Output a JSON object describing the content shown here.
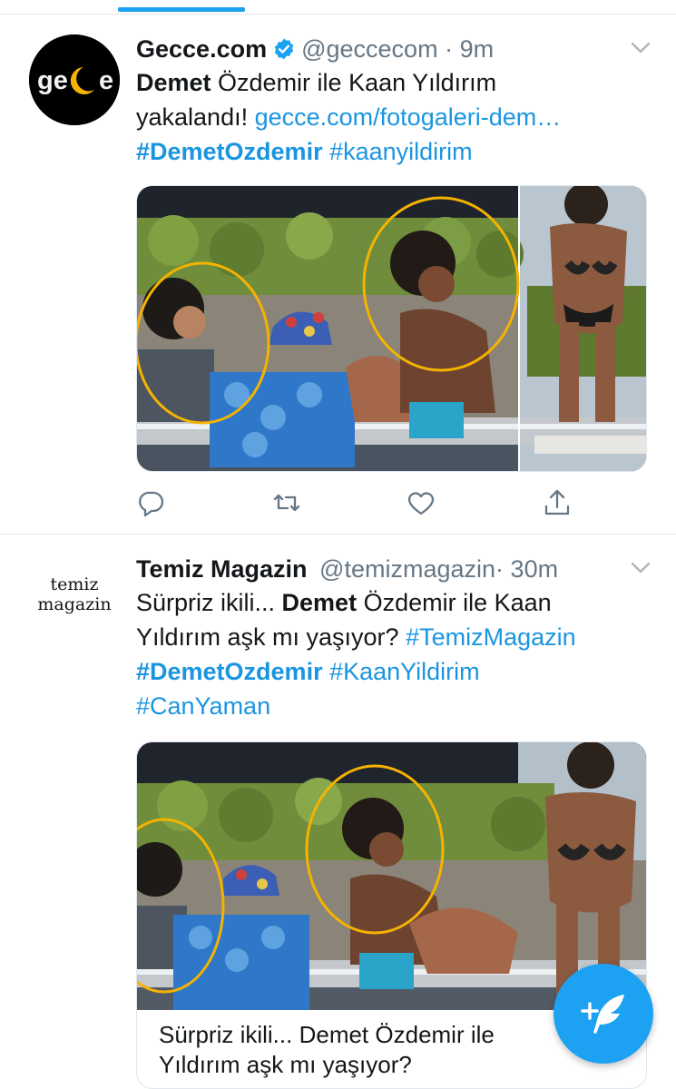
{
  "tweets": [
    {
      "author": {
        "display_name": "Gecce.com",
        "handle": "@geccecom",
        "verified": true,
        "avatar_text": "gecce"
      },
      "time": "9m",
      "separator": "·",
      "text_lines": [
        {
          "parts": [
            {
              "text": "Demet",
              "style": "bold"
            },
            {
              "text": " Özdemir ile Kaan Yıldırım",
              "style": "plain"
            }
          ]
        },
        {
          "parts": [
            {
              "text": "yakalandı! ",
              "style": "plain"
            },
            {
              "text": "gecce.com/fotogaleri-dem…",
              "style": "link"
            }
          ]
        },
        {
          "parts": [
            {
              "text": "#DemetOzdemir",
              "style": "hashtag-bold"
            },
            {
              "text": " #kaanyildirim",
              "style": "link"
            }
          ]
        }
      ]
    },
    {
      "author": {
        "display_name": "Temiz Magazin",
        "handle": "@temizmagazin",
        "verified": false,
        "avatar_line1": "temiz",
        "avatar_line2": "magazin"
      },
      "time": "30m",
      "separator": "·",
      "text_lines": [
        {
          "parts": [
            {
              "text": "Sürpriz ikili... ",
              "style": "plain"
            },
            {
              "text": "Demet",
              "style": "bold"
            },
            {
              "text": " Özdemir ile Kaan",
              "style": "plain"
            }
          ]
        },
        {
          "parts": [
            {
              "text": "Yıldırım aşk mı yaşıyor? ",
              "style": "plain"
            },
            {
              "text": "#TemizMagazin",
              "style": "link"
            }
          ]
        },
        {
          "parts": [
            {
              "text": "#DemetOzdemir",
              "style": "hashtag-bold"
            },
            {
              "text": " #KaanYildirim",
              "style": "link"
            }
          ]
        },
        {
          "parts": [
            {
              "text": "#CanYaman",
              "style": "link"
            }
          ]
        }
      ],
      "card": {
        "line1": "Sürpriz ikili... Demet Özdemir ile",
        "line2": "Yıldırım aşk mı yaşıyor?"
      }
    }
  ],
  "actions": [
    "reply-icon",
    "retweet-icon",
    "like-icon",
    "share-icon"
  ],
  "colors": {
    "accent": "#1da1f2",
    "link": "#1b95e0",
    "secondary_text": "#657786",
    "divider": "#e1e8ed",
    "highlight_circle": "#f5b300"
  },
  "fab_icon": "compose-tweet-icon"
}
